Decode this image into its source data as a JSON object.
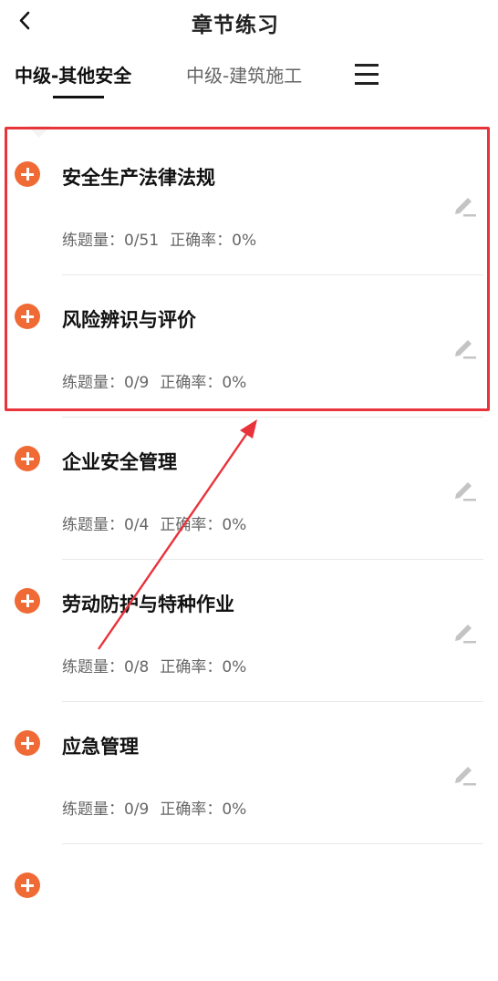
{
  "header": {
    "title": "章节练习"
  },
  "tabs": [
    {
      "label": "中级-其他安全",
      "active": true
    },
    {
      "label": "中级-建筑施工",
      "active": false
    }
  ],
  "list": {
    "items": [
      {
        "title": "安全生产法律法规",
        "count_label": "练题量：0/51",
        "rate_label": "正确率：0%"
      },
      {
        "title": "风险辨识与评价",
        "count_label": "练题量：0/9",
        "rate_label": "正确率：0%"
      },
      {
        "title": "企业安全管理",
        "count_label": "练题量：0/4",
        "rate_label": "正确率：0%"
      },
      {
        "title": "劳动防护与特种作业",
        "count_label": "练题量：0/8",
        "rate_label": "正确率：0%"
      },
      {
        "title": "应急管理",
        "count_label": "练题量：0/9",
        "rate_label": "正确率：0%"
      }
    ]
  },
  "colors": {
    "accent": "#f06a35",
    "highlight": "#e8333b",
    "text": "#111111",
    "muted": "#666666"
  },
  "icons": {
    "back": "chevron-left-icon",
    "menu": "hamburger-menu-icon",
    "expand": "plus-circle-icon",
    "edit": "pencil-edit-icon"
  }
}
